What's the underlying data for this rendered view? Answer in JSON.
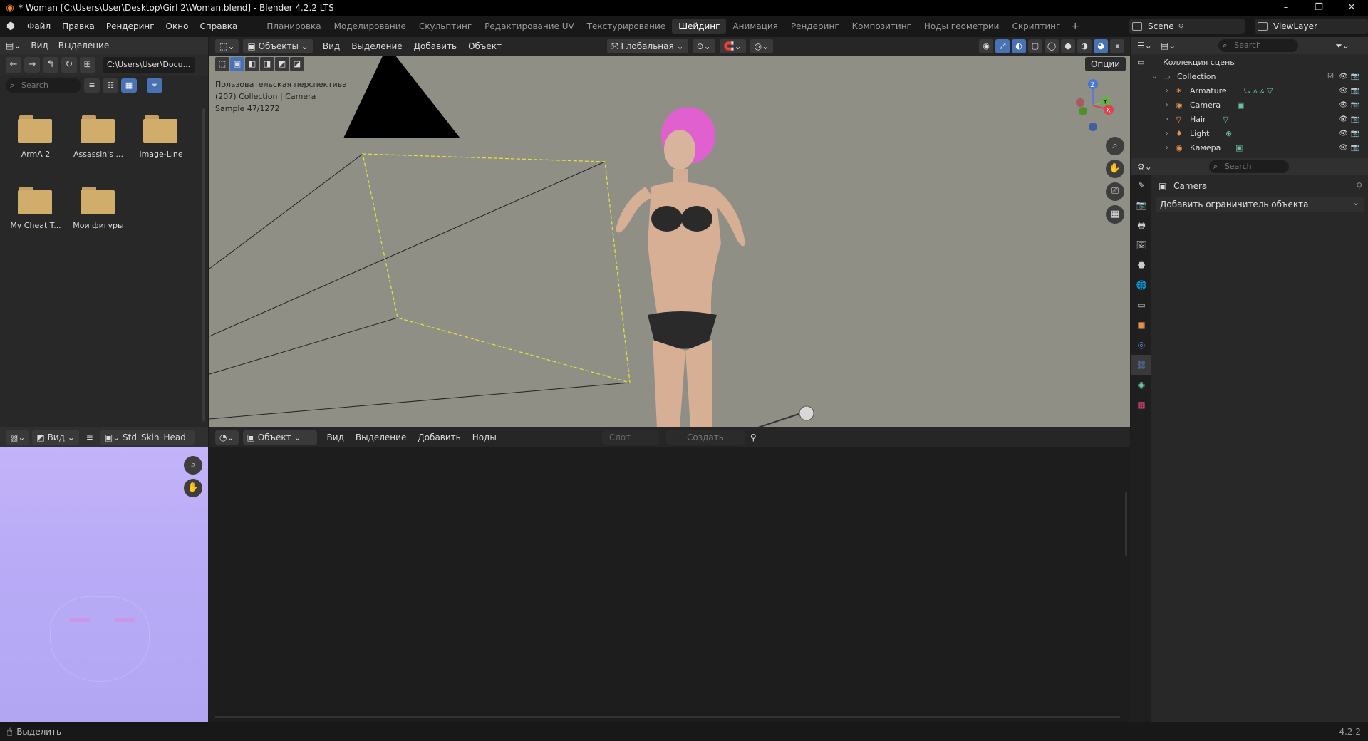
{
  "window": {
    "title": "* Woman [C:\\Users\\User\\Desktop\\Girl 2\\Woman.blend] - Blender 4.2.2 LTS",
    "controls": [
      "–",
      "❐",
      "✕"
    ]
  },
  "topbar": {
    "menu": [
      "Файл",
      "Правка",
      "Рендеринг",
      "Окно",
      "Справка"
    ],
    "workspaces": [
      "Планировка",
      "Моделирование",
      "Скульптинг",
      "Редактирование UV",
      "Текстурирование",
      "Шейдинг",
      "Анимация",
      "Рендеринг",
      "Композитинг",
      "Ноды геометрии",
      "Скриптинг"
    ],
    "active_workspace": "Шейдинг",
    "add_tab": "+",
    "scene": "Scene",
    "view_layer": "ViewLayer"
  },
  "file_browser": {
    "header_menu": [
      "Вид",
      "Выделение"
    ],
    "path": "C:\\Users\\User\\Docu...",
    "search_placeholder": "Search",
    "folders": [
      "ArmA 2",
      "Assassin's ...",
      "Image-Line",
      "My Cheat T...",
      "Мои фигуры"
    ]
  },
  "image_editor": {
    "view_label": "Вид",
    "image_name": "Std_Skin_Head_"
  },
  "viewport": {
    "mode": "Объекты",
    "menu": [
      "Вид",
      "Выделение",
      "Добавить",
      "Объект"
    ],
    "orientation": "Глобальная",
    "options_label": "Опции",
    "info_lines": [
      "Пользовательская перспектива",
      "(207) Collection | Camera",
      "Sample 47/1272"
    ],
    "gizmo_axes": [
      "Z",
      "Y",
      "X"
    ]
  },
  "shader_editor": {
    "mode": "Объект",
    "menu": [
      "Вид",
      "Выделение",
      "Добавить",
      "Ноды"
    ],
    "slot": "Слот",
    "create": "Создать"
  },
  "outliner": {
    "search_placeholder": "Search",
    "scene_collection": "Коллекция сцены",
    "collection": "Collection",
    "items": [
      {
        "name": "Armature",
        "icon_color": "#e09050"
      },
      {
        "name": "Camera",
        "icon_color": "#e09050"
      },
      {
        "name": "Hair",
        "icon_color": "#e09050"
      },
      {
        "name": "Light",
        "icon_color": "#e09050"
      },
      {
        "name": "Камера",
        "icon_color": "#e09050"
      }
    ]
  },
  "properties": {
    "search_placeholder": "Search",
    "object_name": "Camera",
    "add_constraint": "Добавить ограничитель объекта"
  },
  "statusbar": {
    "left": "Выделить",
    "version": "4.2.2"
  },
  "colors": {
    "accent": "#4772b3",
    "viewport_bg": "#8f8f86",
    "folder": "#d1ad6c",
    "hair": "#e060d0"
  }
}
